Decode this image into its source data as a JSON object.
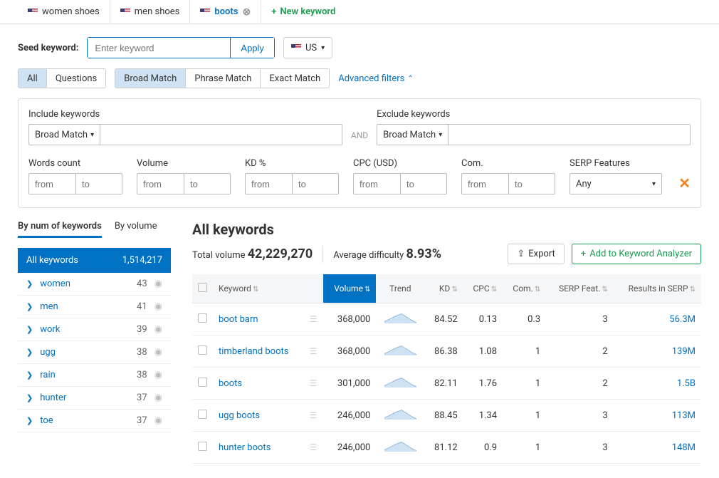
{
  "tabs": [
    {
      "label": "women shoes",
      "active": false
    },
    {
      "label": "men shoes",
      "active": false
    },
    {
      "label": "boots",
      "active": true
    }
  ],
  "new_keyword_label": "New keyword",
  "seed": {
    "label": "Seed keyword:",
    "placeholder": "Enter keyword",
    "apply": "Apply",
    "country": "US"
  },
  "mode_group1": {
    "all": "All",
    "questions": "Questions"
  },
  "mode_group2": {
    "broad": "Broad Match",
    "phrase": "Phrase Match",
    "exact": "Exact Match"
  },
  "advanced_label": "Advanced filters",
  "advanced": {
    "include_label": "Include keywords",
    "exclude_label": "Exclude keywords",
    "match_option": "Broad Match",
    "and": "AND",
    "ranges": {
      "words": "Words count",
      "volume": "Volume",
      "kd": "KD %",
      "cpc": "CPC (USD)",
      "com": "Com."
    },
    "from": "from",
    "to": "to",
    "serp_label": "SERP Features",
    "serp_value": "Any"
  },
  "sidebar": {
    "tab1": "By num of keywords",
    "tab2": "By volume",
    "head_label": "All keywords",
    "head_count": "1,514,217",
    "items": [
      {
        "name": "women",
        "count": "43"
      },
      {
        "name": "men",
        "count": "41"
      },
      {
        "name": "work",
        "count": "39"
      },
      {
        "name": "ugg",
        "count": "38"
      },
      {
        "name": "rain",
        "count": "38"
      },
      {
        "name": "hunter",
        "count": "37"
      },
      {
        "name": "toe",
        "count": "37"
      }
    ]
  },
  "content": {
    "title": "All keywords",
    "total_label": "Total volume",
    "total_value": "42,229,270",
    "avg_label": "Average difficulty",
    "avg_value": "8.93%",
    "export": "Export",
    "add": "Add to Keyword Analyzer",
    "columns": {
      "keyword": "Keyword",
      "volume": "Volume",
      "trend": "Trend",
      "kd": "KD",
      "cpc": "CPC",
      "com": "Com.",
      "serp_feat": "SERP Feat.",
      "results": "Results in SERP"
    },
    "rows": [
      {
        "keyword": "boot barn",
        "volume": "368,000",
        "kd": "84.52",
        "cpc": "0.13",
        "com": "0.3",
        "serp": "3",
        "results": "56.3M"
      },
      {
        "keyword": "timberland boots",
        "volume": "368,000",
        "kd": "86.38",
        "cpc": "1.08",
        "com": "1",
        "serp": "2",
        "results": "139M"
      },
      {
        "keyword": "boots",
        "volume": "301,000",
        "kd": "82.11",
        "cpc": "1.76",
        "com": "1",
        "serp": "2",
        "results": "1.5B"
      },
      {
        "keyword": "ugg boots",
        "volume": "246,000",
        "kd": "88.45",
        "cpc": "1.34",
        "com": "1",
        "serp": "3",
        "results": "113M"
      },
      {
        "keyword": "hunter boots",
        "volume": "246,000",
        "kd": "81.12",
        "cpc": "0.9",
        "com": "1",
        "serp": "3",
        "results": "148M"
      }
    ]
  }
}
